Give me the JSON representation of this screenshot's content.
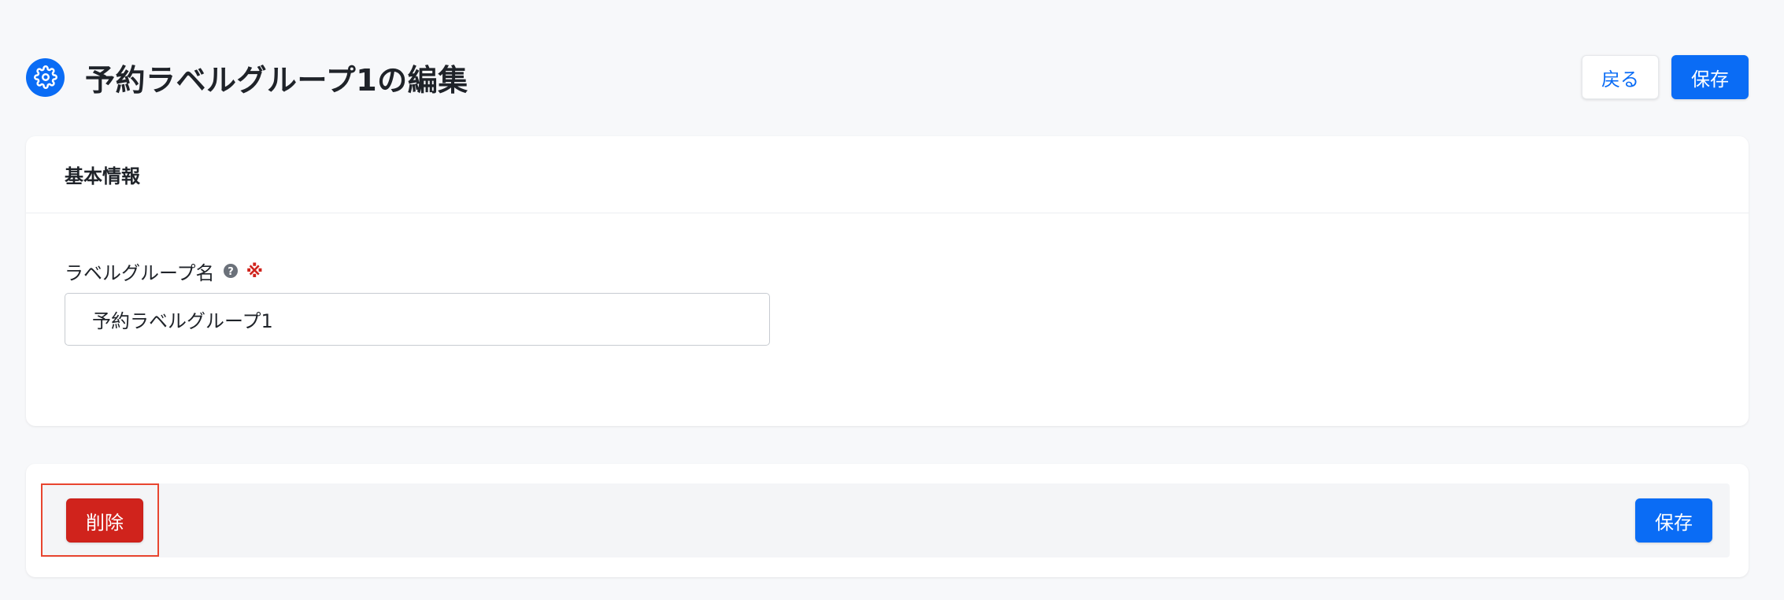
{
  "header": {
    "title": "予約ラベルグループ1の編集",
    "back_label": "戻る",
    "save_label": "保存"
  },
  "basic_info": {
    "title": "基本情報",
    "group_name": {
      "label": "ラベルグループ名",
      "required_mark": "※",
      "value": "予約ラベルグループ1"
    }
  },
  "actions": {
    "delete_label": "削除",
    "save_label": "保存"
  },
  "colors": {
    "primary": "#0a6cf5",
    "danger": "#d0231c",
    "background": "#f7f8fa",
    "highlight": "#e8452f"
  },
  "icons": {
    "title_icon": "gear-icon",
    "help_icon": "question-circle-icon"
  }
}
